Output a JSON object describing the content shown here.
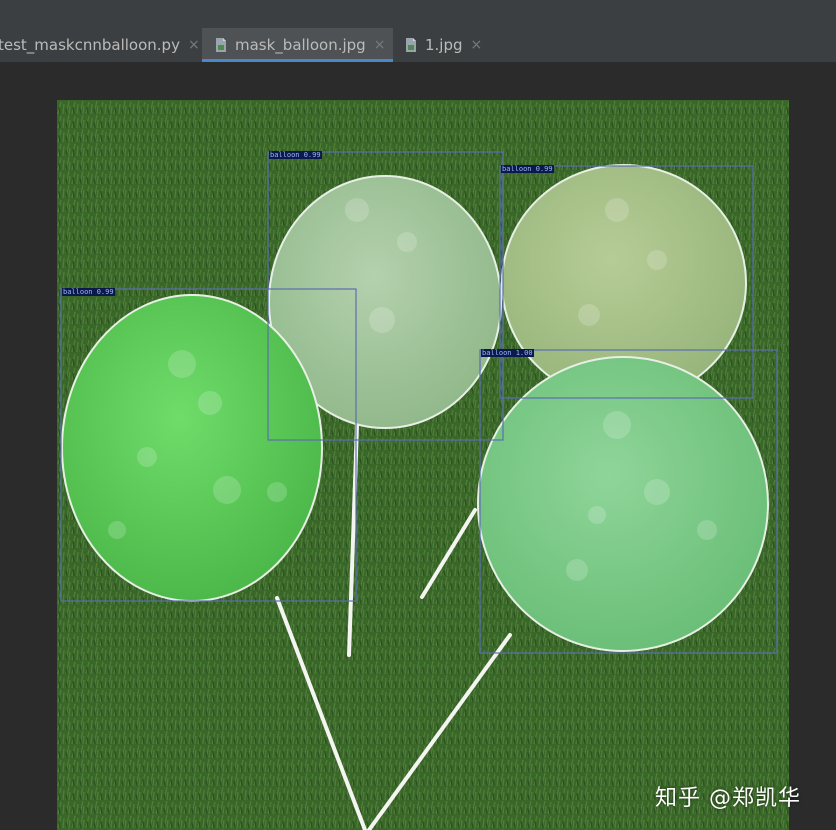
{
  "tabs": [
    {
      "label": "test_maskcnnballoon.py",
      "icon": "python-file-icon",
      "active": false
    },
    {
      "label": "mask_balloon.jpg",
      "icon": "image-file-icon",
      "active": true
    },
    {
      "label": "1.jpg",
      "icon": "image-file-icon",
      "active": false
    }
  ],
  "close_glyph": "×",
  "detections": [
    {
      "label": "balloon 0.99"
    },
    {
      "label": "balloon 0.99"
    },
    {
      "label": "balloon 0.99"
    },
    {
      "label": "balloon 1.00"
    }
  ],
  "watermark": "知乎 @郑凯华",
  "colors": {
    "accent": "#4a88c7",
    "box": "#5a6fb0",
    "mask_bright_green": "#5fcf5f",
    "mask_light": "#9fc79a",
    "mask_olive": "#a9c28a",
    "mask_mint": "#7cc887",
    "grass": "#3f6a2c"
  }
}
